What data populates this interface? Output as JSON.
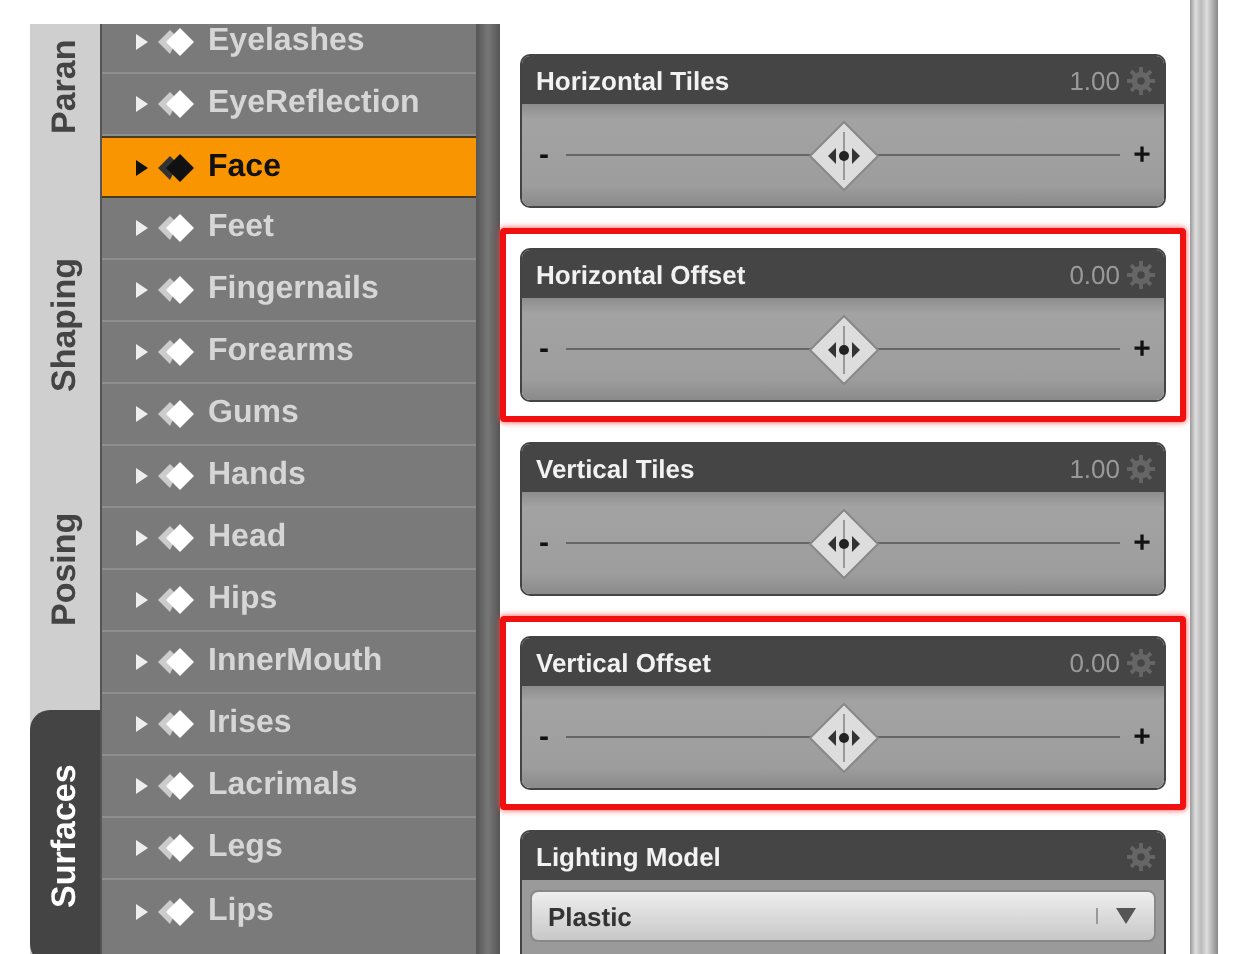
{
  "side_tabs": [
    {
      "label": "Paran",
      "selected": false
    },
    {
      "label": "Shaping",
      "selected": false
    },
    {
      "label": "Posing",
      "selected": false
    },
    {
      "label": "Surfaces",
      "selected": true
    }
  ],
  "surfaces": [
    {
      "label": "Eyelashes",
      "selected": false
    },
    {
      "label": "EyeReflection",
      "selected": false
    },
    {
      "label": "Face",
      "selected": true
    },
    {
      "label": "Feet",
      "selected": false
    },
    {
      "label": "Fingernails",
      "selected": false
    },
    {
      "label": "Forearms",
      "selected": false
    },
    {
      "label": "Gums",
      "selected": false
    },
    {
      "label": "Hands",
      "selected": false
    },
    {
      "label": "Head",
      "selected": false
    },
    {
      "label": "Hips",
      "selected": false
    },
    {
      "label": "InnerMouth",
      "selected": false
    },
    {
      "label": "Irises",
      "selected": false
    },
    {
      "label": "Lacrimals",
      "selected": false
    },
    {
      "label": "Legs",
      "selected": false
    },
    {
      "label": "Lips",
      "selected": false
    }
  ],
  "properties": [
    {
      "kind": "slider",
      "title": "Horizontal Tiles",
      "value": "1.00",
      "minus": "-",
      "plus": "+",
      "level": 0.5,
      "highlighted": false
    },
    {
      "kind": "slider",
      "title": "Horizontal Offset",
      "value": "0.00",
      "minus": "-",
      "plus": "+",
      "level": 0.5,
      "highlighted": true
    },
    {
      "kind": "slider",
      "title": "Vertical Tiles",
      "value": "1.00",
      "minus": "-",
      "plus": "+",
      "level": 0.5,
      "highlighted": false
    },
    {
      "kind": "slider",
      "title": "Vertical Offset",
      "value": "0.00",
      "minus": "-",
      "plus": "+",
      "level": 0.5,
      "highlighted": true
    },
    {
      "kind": "dropdown",
      "title": "Lighting Model",
      "value": "Plastic",
      "highlighted": false
    }
  ]
}
